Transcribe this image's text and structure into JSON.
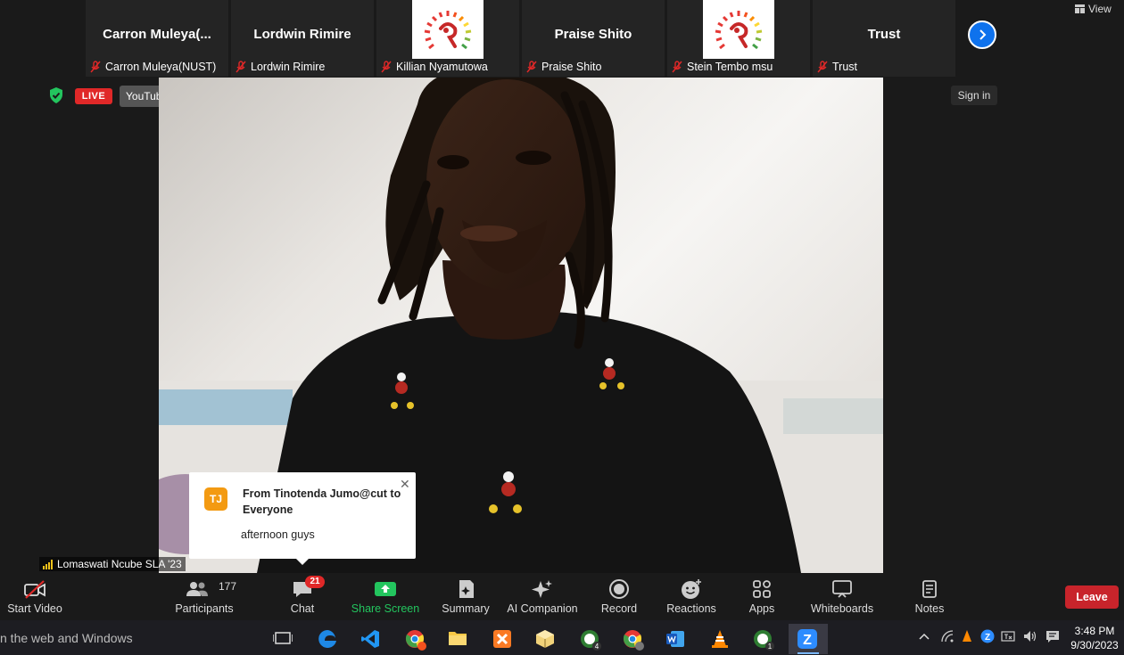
{
  "window": {
    "view_label": "View"
  },
  "participants": [
    {
      "big_name": "Carron   Muleya(...",
      "foot_name": "Carron   Muleya(NUST)",
      "has_logo": false
    },
    {
      "big_name": "Lordwin Rimire",
      "foot_name": "Lordwin Rimire",
      "has_logo": false
    },
    {
      "big_name": "",
      "foot_name": "Killian Nyamutowa",
      "has_logo": true
    },
    {
      "big_name": "Praise Shito",
      "foot_name": "Praise Shito",
      "has_logo": false
    },
    {
      "big_name": "",
      "foot_name": "Stein Tembo msu",
      "has_logo": true
    },
    {
      "big_name": "Trust",
      "foot_name": "Trust",
      "has_logo": false
    }
  ],
  "status": {
    "live_label": "LIVE",
    "stream_target": "YouTube",
    "sign_in": "Sign in"
  },
  "active_speaker": "Lomaswati Ncube SLA '23",
  "chat_popup": {
    "initials": "TJ",
    "from_line": "From Tinotenda Jumo@cut to Everyone",
    "message": "afternoon guys"
  },
  "toolbar": {
    "start_video": "Start Video",
    "participants": "Participants",
    "participant_count": "177",
    "chat": "Chat",
    "chat_unread": "21",
    "share_screen": "Share Screen",
    "summary": "Summary",
    "ai_companion": "AI Companion",
    "record": "Record",
    "reactions": "Reactions",
    "apps": "Apps",
    "whiteboards": "Whiteboards",
    "notes": "Notes",
    "leave": "Leave"
  },
  "taskbar": {
    "search_text": "n the web and Windows",
    "chrome_badge_1": "4",
    "chrome_badge_2": "1",
    "time": "3:48 PM",
    "date": "9/30/2023"
  },
  "colors": {
    "zoom_blue": "#0e72ed",
    "live_red": "#e02828",
    "share_green": "#23c55e",
    "leave_red": "#c8242b",
    "chat_avatar": "#f39a12"
  }
}
